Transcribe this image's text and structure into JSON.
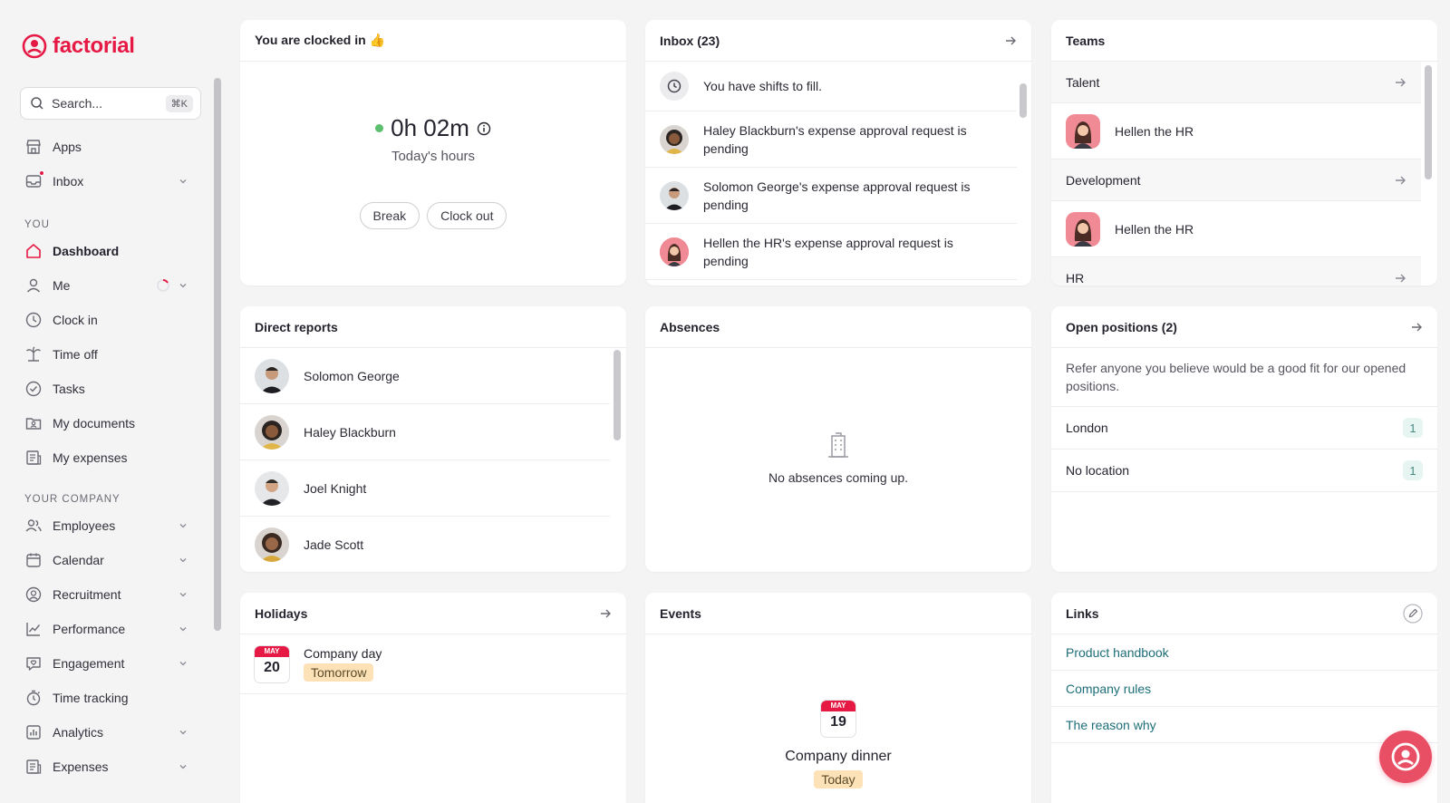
{
  "brand": {
    "name": "factorial",
    "accent": "#e51943"
  },
  "search": {
    "placeholder": "Search...",
    "shortcut": "⌘K"
  },
  "nav_top": [
    {
      "label": "Apps",
      "icon": "store-icon"
    },
    {
      "label": "Inbox",
      "icon": "inbox-icon"
    }
  ],
  "section_you": "YOU",
  "nav_you": [
    {
      "label": "Dashboard",
      "icon": "home-icon"
    },
    {
      "label": "Me",
      "icon": "user-icon"
    },
    {
      "label": "Clock in",
      "icon": "clock-icon"
    },
    {
      "label": "Time off",
      "icon": "palm-icon"
    },
    {
      "label": "Tasks",
      "icon": "check-circle-icon"
    },
    {
      "label": "My documents",
      "icon": "folder-user-icon"
    },
    {
      "label": "My expenses",
      "icon": "receipt-icon"
    }
  ],
  "section_company": "YOUR COMPANY",
  "nav_company": [
    {
      "label": "Employees",
      "icon": "people-icon"
    },
    {
      "label": "Calendar",
      "icon": "calendar-icon"
    },
    {
      "label": "Recruitment",
      "icon": "recruit-icon"
    },
    {
      "label": "Performance",
      "icon": "chart-line-icon"
    },
    {
      "label": "Engagement",
      "icon": "chat-heart-icon"
    },
    {
      "label": "Time tracking",
      "icon": "stopwatch-icon"
    },
    {
      "label": "Analytics",
      "icon": "bar-chart-icon"
    },
    {
      "label": "Expenses",
      "icon": "receipt-icon"
    }
  ],
  "clock": {
    "title": "You are clocked in 👍",
    "time": "0h 02m",
    "caption": "Today's hours",
    "break_label": "Break",
    "clockout_label": "Clock out"
  },
  "inbox": {
    "title": "Inbox (23)",
    "items": [
      {
        "text": "You have shifts to fill."
      },
      {
        "text": "Haley Blackburn's expense approval request is pending"
      },
      {
        "text": "Solomon George's expense approval request is pending"
      },
      {
        "text": "Hellen the HR's expense approval request is pending"
      }
    ]
  },
  "teams": {
    "title": "Teams",
    "groups": [
      {
        "name": "Talent",
        "member": "Hellen the HR"
      },
      {
        "name": "Development",
        "member": "Hellen the HR"
      },
      {
        "name": "HR"
      }
    ]
  },
  "direct_reports": {
    "title": "Direct reports",
    "people": [
      "Solomon George",
      "Haley Blackburn",
      "Joel Knight",
      "Jade Scott"
    ]
  },
  "absences": {
    "title": "Absences",
    "empty": "No absences coming up."
  },
  "open_positions": {
    "title": "Open positions (2)",
    "description": "Refer anyone you believe would be a good fit for our opened positions.",
    "locations": [
      {
        "name": "London",
        "count": "1"
      },
      {
        "name": "No location",
        "count": "1"
      }
    ]
  },
  "holidays": {
    "title": "Holidays",
    "items": [
      {
        "month": "MAY",
        "day": "20",
        "name": "Company day",
        "tag": "Tomorrow"
      }
    ]
  },
  "events": {
    "title": "Events",
    "items": [
      {
        "month": "MAY",
        "day": "19",
        "name": "Company dinner",
        "tag": "Today"
      }
    ]
  },
  "links": {
    "title": "Links",
    "items": [
      "Product handbook",
      "Company rules",
      "The reason why"
    ]
  }
}
